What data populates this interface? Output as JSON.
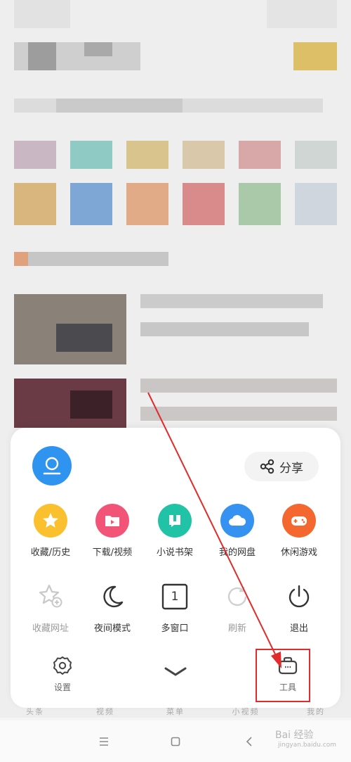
{
  "menu": {
    "share_label": "分享",
    "row1": [
      {
        "label": "收藏/历史",
        "icon": "star-icon",
        "color": "#fbc02d"
      },
      {
        "label": "下载/视频",
        "icon": "folder-play-icon",
        "color": "#f25477"
      },
      {
        "label": "小说书架",
        "icon": "book-icon",
        "color": "#21c3a6"
      },
      {
        "label": "我的网盘",
        "icon": "cloud-icon",
        "color": "#3592f1"
      },
      {
        "label": "休闲游戏",
        "icon": "gamepad-icon",
        "color": "#f4672e"
      }
    ],
    "row2": [
      {
        "label": "收藏网址",
        "icon": "star-add-icon"
      },
      {
        "label": "夜间模式",
        "icon": "moon-icon"
      },
      {
        "label": "多窗口",
        "icon": "window-count-icon",
        "badge": "1"
      },
      {
        "label": "刷新",
        "icon": "refresh-icon"
      },
      {
        "label": "退出",
        "icon": "power-icon"
      }
    ],
    "settings_label": "设置",
    "tools_label": "工具"
  },
  "bottom_nav": [
    "头条",
    "视频",
    "菜单",
    "小视频",
    "我的"
  ],
  "watermark": {
    "text": "Bai 经验",
    "sub": "jingyan.baidu.com"
  },
  "colors": {
    "annotation": "#e22b2b"
  }
}
